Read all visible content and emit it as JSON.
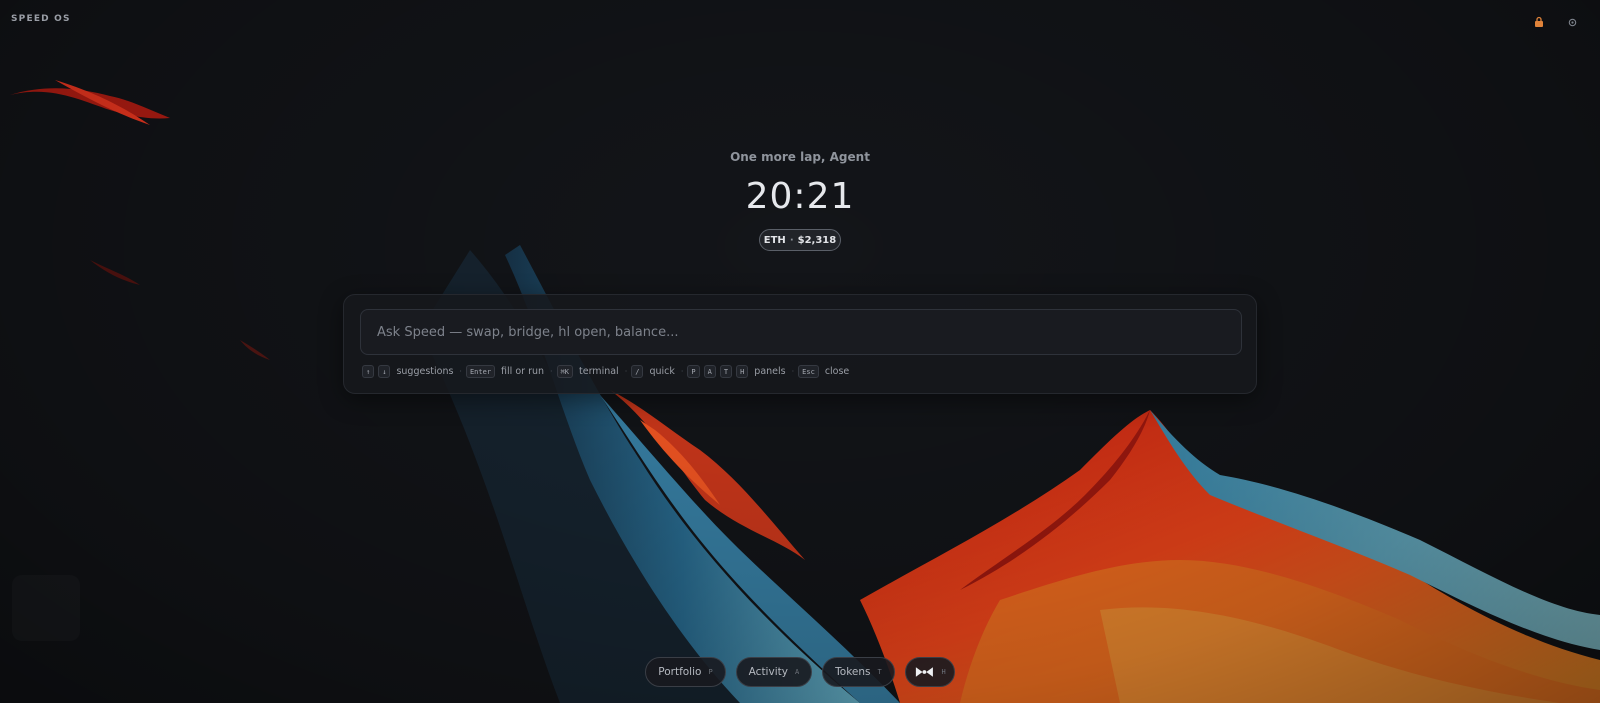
{
  "app": {
    "brand": "SPEED OS"
  },
  "header": {
    "icons": [
      "lock-icon",
      "gear-icon"
    ]
  },
  "hero": {
    "greeting": "One more lap, Agent",
    "time": "20:21",
    "price": {
      "symbol": "ETH",
      "separator": "·",
      "value": "$2,318"
    }
  },
  "command": {
    "placeholder": "Ask Speed — swap, bridge, hl open, balance...",
    "hints": {
      "up_key": "↑",
      "down_key": "↓",
      "suggestions": "suggestions",
      "enter_key": "Enter",
      "fill_or_run": "fill or run",
      "cmd_key": "⌘K",
      "terminal": "terminal",
      "slash_key": "/",
      "quick": "quick",
      "p_key": "P",
      "a_key": "A",
      "t_key": "T",
      "h_key": "H",
      "panels": "panels",
      "esc_key": "Esc",
      "close": "close"
    }
  },
  "dock": {
    "portfolio": {
      "label": "Portfolio",
      "key": "P"
    },
    "activity": {
      "label": "Activity",
      "key": "A"
    },
    "tokens": {
      "label": "Tokens",
      "key": "T"
    },
    "logo": {
      "key": "H"
    }
  },
  "colors": {
    "background": "#131519",
    "accent_red": "#e8401f",
    "accent_orange": "#ff7a22",
    "accent_blue": "#2f7fa6",
    "lock": "#e0833a"
  }
}
